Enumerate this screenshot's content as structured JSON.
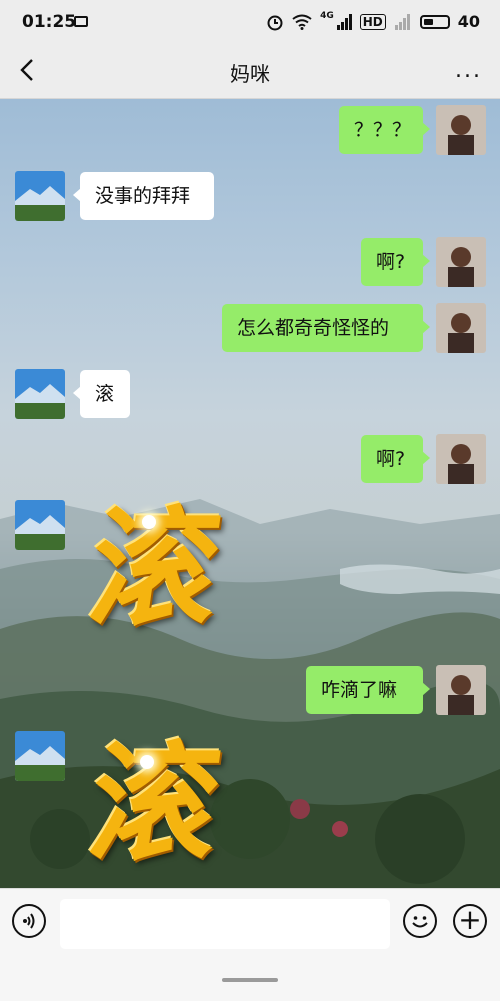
{
  "status_bar": {
    "time": "01:25",
    "battery": "40",
    "network": "4G",
    "hd": "HD"
  },
  "header": {
    "title": "妈咪",
    "back_icon": "chevron-left-icon",
    "more_icon": "more-dots-icon",
    "more_glyph": "..."
  },
  "messages": [
    {
      "side": "out",
      "type": "text",
      "text": "？？？"
    },
    {
      "side": "in",
      "type": "text",
      "text": "没事的拜拜"
    },
    {
      "side": "out",
      "type": "text",
      "text": "啊?"
    },
    {
      "side": "out",
      "type": "text",
      "text": "怎么都奇奇怪怪的"
    },
    {
      "side": "in",
      "type": "text",
      "text": "滚"
    },
    {
      "side": "out",
      "type": "text",
      "text": "啊?"
    },
    {
      "side": "in",
      "type": "sticker",
      "text": "滚"
    },
    {
      "side": "out",
      "type": "text",
      "text": "咋滴了嘛"
    },
    {
      "side": "in",
      "type": "sticker",
      "text": "滚"
    }
  ],
  "input_bar": {
    "placeholder": "",
    "voice_icon": "voice-icon",
    "emoji_icon": "emoji-icon",
    "plus_icon": "plus-icon",
    "plus_glyph": "+"
  },
  "colors": {
    "outgoing_bubble": "#95ec69",
    "incoming_bubble": "#ffffff",
    "header_bg": "#ededed",
    "sticker_gold": "#f5b40f"
  }
}
